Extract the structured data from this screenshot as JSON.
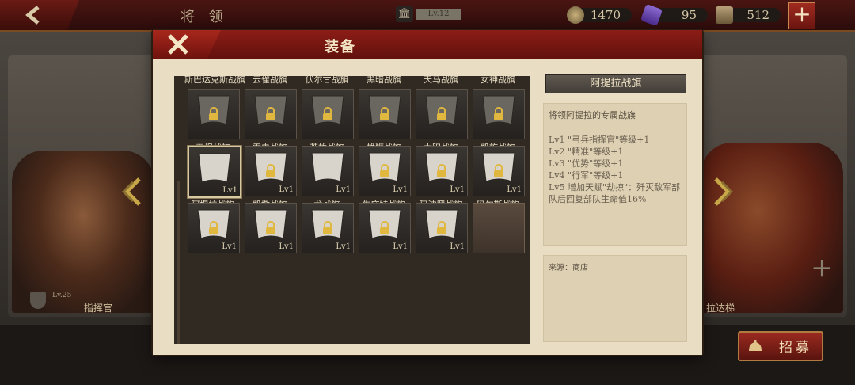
{
  "top_bar": {
    "title": "将 领",
    "level": "Lv.12",
    "coins": "1470",
    "gems": "95",
    "troops": "512",
    "plus": "+"
  },
  "heroes": {
    "left_caption": "指挥官",
    "left_level": "Lv.25",
    "right_caption": "拉达梯"
  },
  "recruit_button": "招募",
  "modal": {
    "title": "装备",
    "grid": {
      "row0": [
        "斯巴达克斯战旗",
        "云雀战旗",
        "伏尔甘战旗",
        "黑暗战旗",
        "天马战旗",
        "女神战旗"
      ],
      "row1": [
        "泰坦战旗",
        "雷电战旗",
        "英雄战旗",
        "雄狮战旗",
        "太阳战旗",
        "凯旋战旗"
      ],
      "row2": [
        "阿提拉战旗",
        "凯撒战旗",
        "龙战旗",
        "朱庇特战旗",
        "阿波罗战旗",
        "玛尔斯战旗"
      ],
      "level_tag": "Lv1"
    },
    "detail": {
      "title": "阿提拉战旗",
      "description": "将领阿提拉的专属战旗",
      "lines": [
        "Lv1 \"弓兵指挥官\"等级+1",
        "Lv2 \"精准\"等级+1",
        "Lv3 \"优势\"等级+1",
        "Lv4 \"行军\"等级+1",
        "Lv5 增加天赋\"劫掠\"：歼灭敌军部队后回复部队生命值16%"
      ],
      "source": "来源：商店"
    }
  },
  "colors": {
    "header_red": "#8c1d16",
    "parchment": "#e9dec4",
    "grid_dark": "#312a22",
    "lock_gold": "#e0b840"
  }
}
